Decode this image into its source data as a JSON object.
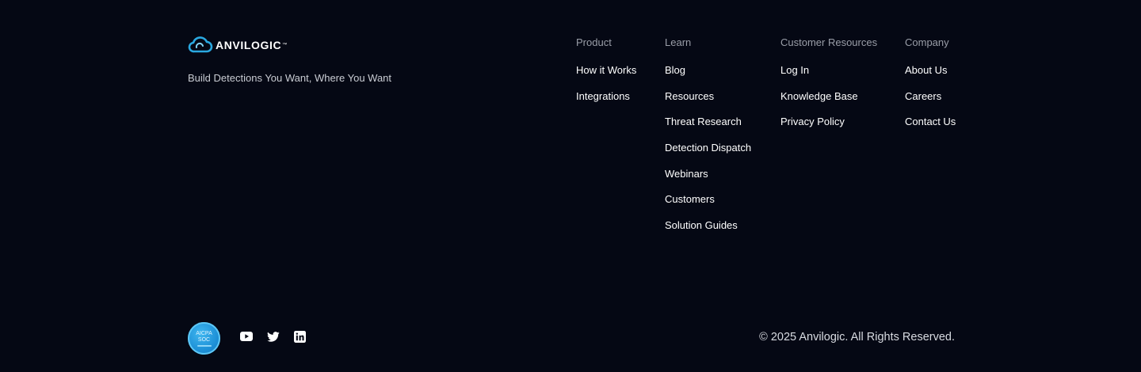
{
  "brand": {
    "name": "ANVILOGIC",
    "tm": "™",
    "logo_icon": "cloud-logo-icon",
    "tagline": "Build Detections You Want, Where You Want"
  },
  "columns": {
    "product": {
      "heading": "Product",
      "links": [
        "How it Works",
        "Integrations"
      ]
    },
    "learn": {
      "heading": "Learn",
      "links": [
        "Blog",
        "Resources",
        "Threat Research",
        "Detection Dispatch",
        "Webinars",
        "Customers",
        "Solution Guides"
      ]
    },
    "customer": {
      "heading": "Customer Resources",
      "links": [
        "Log In",
        "Knowledge Base",
        "Privacy Policy"
      ]
    },
    "company": {
      "heading": "Company",
      "links": [
        "About Us",
        "Careers",
        "Contact Us"
      ]
    }
  },
  "badge": {
    "line1": "AICPA",
    "line2": "SOC"
  },
  "social": {
    "youtube_icon": "youtube-icon",
    "twitter_icon": "twitter-icon",
    "linkedin_icon": "linkedin-icon"
  },
  "copyright": "© 2025 Anvilogic. All Rights Reserved.",
  "colors": {
    "background": "#050814",
    "heading": "#9a9ea8",
    "link": "#ffffff",
    "accent": "#2aa8e0"
  }
}
